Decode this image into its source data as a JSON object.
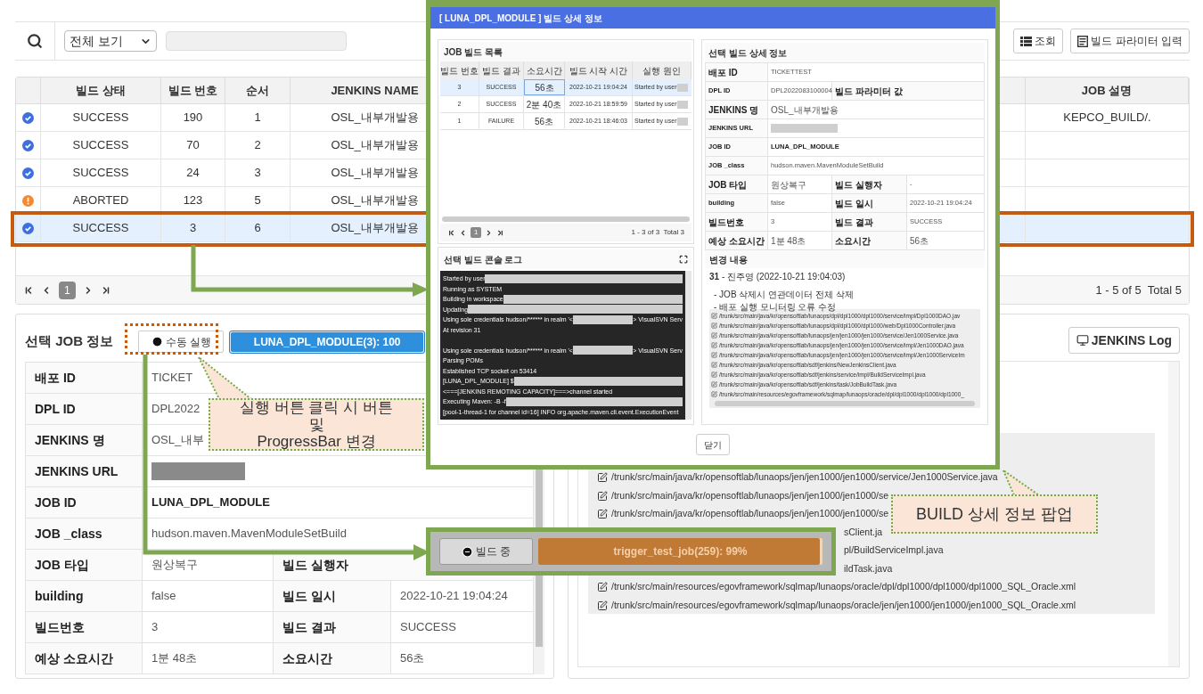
{
  "toolbar": {
    "filter": "전체 보기",
    "buttons": [
      {
        "kind": "list",
        "label": "조회"
      },
      {
        "kind": "form",
        "label": "빌드 파라미터 입력"
      }
    ]
  },
  "build_table": {
    "columns": [
      "빌드 상태",
      "빌드 번호",
      "순서",
      "JENKINS NAME",
      "JOB 설명"
    ],
    "rows": [
      {
        "kind": "success",
        "status": "SUCCESS",
        "number": "190",
        "order": "1",
        "jenkins": "OSL_내부개발용",
        "description": "KEPCO_BUILD/.",
        "selected": false
      },
      {
        "kind": "success",
        "status": "SUCCESS",
        "number": "70",
        "order": "2",
        "jenkins": "OSL_내부개발용",
        "selected": false
      },
      {
        "kind": "success",
        "status": "SUCCESS",
        "number": "24",
        "order": "3",
        "jenkins": "OSL_내부개발용",
        "selected": false
      },
      {
        "kind": "aborted",
        "status": "ABORTED",
        "number": "123",
        "order": "5",
        "jenkins": "OSL_내부개발용",
        "selected": false
      },
      {
        "kind": "success",
        "status": "SUCCESS",
        "number": "3",
        "order": "6",
        "jenkins": "OSL_내부개발용",
        "selected": true
      }
    ],
    "pagination": {
      "page": "1",
      "summary": "1 - 5 of 5  Total 5"
    }
  },
  "job_info": {
    "title": "선택 JOB 정보",
    "run_button": "수동 실행",
    "progress": {
      "label": "LUNA_DPL_MODULE(3): 100",
      "level": 1
    },
    "rows": [
      [
        {
          "kind": "label",
          "text": "배포 ID"
        },
        {
          "kind": "value",
          "text": "TICKET"
        }
      ],
      [
        {
          "kind": "label",
          "text": "DPL ID"
        },
        {
          "kind": "value",
          "text": "DPL2022"
        }
      ],
      [
        {
          "kind": "label",
          "text": "JENKINS 명"
        },
        {
          "kind": "value",
          "text": "OSL_내부"
        }
      ],
      [
        {
          "kind": "label",
          "text": "JENKINS URL"
        },
        {
          "kind": "redacted"
        }
      ],
      [
        {
          "kind": "label",
          "text": "JOB ID"
        },
        {
          "kind": "strong",
          "text": "LUNA_DPL_MODULE"
        }
      ],
      [
        {
          "kind": "label",
          "text": "JOB _class"
        },
        {
          "kind": "value",
          "text": "hudson.maven.MavenModuleSetBuild"
        }
      ],
      [
        {
          "kind": "label",
          "text": "JOB 타입"
        },
        {
          "kind": "value",
          "text": "원상복구"
        },
        {
          "kind": "label",
          "text": "빌드 실행자"
        }
      ],
      [
        {
          "kind": "label",
          "text": "building"
        },
        {
          "kind": "value",
          "text": "false"
        },
        {
          "kind": "label",
          "text": "빌드 일시"
        },
        {
          "kind": "value",
          "text": "2022-10-21 19:04:24"
        }
      ],
      [
        {
          "kind": "label",
          "text": "빌드번호"
        },
        {
          "kind": "value",
          "text": "3"
        },
        {
          "kind": "label",
          "text": "빌드 결과"
        },
        {
          "kind": "value",
          "text": "SUCCESS"
        }
      ],
      [
        {
          "kind": "label",
          "text": "예상 소요시간"
        },
        {
          "kind": "value",
          "text": "1분 48초"
        },
        {
          "kind": "label",
          "text": "소요시간"
        },
        {
          "kind": "value",
          "text": "56초"
        }
      ]
    ]
  },
  "jenkins_log": {
    "button": "JENKINS Log",
    "files": [
      {
        "kind": "full",
        "text": "/trunk/src/main/java/kr/opensoftlab/lunaops/jen/jen1000/jen1000/service/Jen1000Service.java"
      },
      {
        "kind": "full",
        "text": "/trunk/src/main/java/kr/opensoftlab/lunaops/jen/jen1000/jen1000/se"
      },
      {
        "kind": "full",
        "text": "/trunk/src/main/java/kr/opensoftlab/lunaops/jen/jen1000/jen1000/se"
      },
      {
        "kind": "tail",
        "text": "sClient.ja"
      },
      {
        "kind": "tail",
        "text": "pl/BuildServiceImpl.java"
      },
      {
        "kind": "tail",
        "text": "ildTask.java"
      },
      {
        "kind": "full",
        "text": "/trunk/src/main/resources/egovframework/sqlmap/lunaops/oracle/dpl/dpl1000/dpl1000/dpl1000_SQL_Oracle.xml"
      },
      {
        "kind": "full",
        "text": "/trunk/src/main/resources/egovframework/sqlmap/lunaops/oracle/jen/jen1000/jen1000/jen1000_SQL_Oracle.xml"
      }
    ]
  },
  "popup": {
    "title": "[ LUNA_DPL_MODULE ] 빌드 상세 정보",
    "builds": {
      "title": "JOB 빌드 목록",
      "columns": [
        "빌드 번호",
        "빌드 결과",
        "소요시간",
        "빌드 시작 시간",
        "실행 원인"
      ],
      "rows": [
        {
          "number": "3",
          "result": "SUCCESS",
          "duration": "56초",
          "started": "2022-10-21 19:04:24",
          "cause": "Started by user",
          "selected": true
        },
        {
          "number": "2",
          "result": "SUCCESS",
          "duration": "2분 40초",
          "started": "2022-10-21 18:59:59",
          "cause": "Started by user",
          "selected": false
        },
        {
          "number": "1",
          "result": "FAILURE",
          "duration": "56초",
          "started": "2022-10-21 18:46:03",
          "cause": "Started by user",
          "selected": false
        }
      ],
      "pagination": {
        "page": "1",
        "summary": "1 - 3 of 3  Total 3"
      }
    },
    "console": {
      "title": "선택 빌드 콘솔 로그",
      "lines": [
        {
          "kind": "text",
          "parts": [
            {
              "kind": "text",
              "text": "Started by user"
            },
            {
              "kind": "redacted"
            }
          ]
        },
        {
          "kind": "text",
          "parts": [
            {
              "kind": "text",
              "text": "Running as SYSTEM"
            }
          ]
        },
        {
          "kind": "text",
          "parts": [
            {
              "kind": "text",
              "text": "Building in workspace"
            },
            {
              "kind": "redacted"
            }
          ]
        },
        {
          "kind": "text",
          "parts": [
            {
              "kind": "text",
              "text": "Updating"
            },
            {
              "kind": "redacted"
            }
          ]
        },
        {
          "kind": "text",
          "parts": [
            {
              "kind": "text",
              "text": "Using sole credentials hudson/****** in realm '<"
            },
            {
              "kind": "redacted"
            },
            {
              "kind": "text",
              "text": "> VisualSVN Serv"
            }
          ]
        },
        {
          "kind": "text",
          "parts": [
            {
              "kind": "text",
              "text": "At revision 31"
            }
          ]
        },
        {
          "kind": "blank"
        },
        {
          "kind": "text",
          "parts": [
            {
              "kind": "text",
              "text": "Using sole credentials hudson/****** in realm '<"
            },
            {
              "kind": "redacted"
            },
            {
              "kind": "text",
              "text": "> VisualSVN Serv"
            }
          ]
        },
        {
          "kind": "text",
          "parts": [
            {
              "kind": "text",
              "text": "Parsing POMs"
            }
          ]
        },
        {
          "kind": "text",
          "parts": [
            {
              "kind": "text",
              "text": "Established TCP socket on 53414"
            }
          ]
        },
        {
          "kind": "text",
          "parts": [
            {
              "kind": "text",
              "text": "[LUNA_DPL_MODULE] $"
            },
            {
              "kind": "redacted"
            }
          ]
        },
        {
          "kind": "text",
          "parts": [
            {
              "kind": "text",
              "text": "<===[JENKINS REMOTING CAPACITY]===>channel started"
            }
          ]
        },
        {
          "kind": "text",
          "parts": [
            {
              "kind": "text",
              "text": "Executing Maven:  -B -f"
            },
            {
              "kind": "redacted"
            }
          ]
        },
        {
          "kind": "text",
          "parts": [
            {
              "kind": "text",
              "text": "[pool-1-thread-1 for channel id=16] INFO org.apache.maven.cli.event.ExecutionEvent"
            }
          ]
        }
      ]
    },
    "detail": {
      "title": "선택 빌드 상세 정보",
      "rows": [
        [
          {
            "kind": "label",
            "text": "배포 ID"
          },
          {
            "kind": "value",
            "text": "TICKETTEST"
          }
        ],
        [
          {
            "kind": "label",
            "text": "DPL ID"
          },
          {
            "kind": "value",
            "text": "DPL2022083100004"
          },
          {
            "kind": "label",
            "text": "빌드 파라미터 값"
          }
        ],
        [
          {
            "kind": "label",
            "text": "JENKINS 명"
          },
          {
            "kind": "value",
            "text": "OSL_내부개발용"
          }
        ],
        [
          {
            "kind": "label",
            "text": "JENKINS URL"
          },
          {
            "kind": "redacted"
          }
        ],
        [
          {
            "kind": "label",
            "text": "JOB ID"
          },
          {
            "kind": "strong",
            "text": "LUNA_DPL_MODULE"
          }
        ],
        [
          {
            "kind": "label",
            "text": "JOB _class"
          },
          {
            "kind": "value",
            "text": "hudson.maven.MavenModuleSetBuild"
          }
        ],
        [
          {
            "kind": "label",
            "text": "JOB 타입"
          },
          {
            "kind": "value",
            "text": "원상복구"
          },
          {
            "kind": "label",
            "text": "빌드 실행자"
          },
          {
            "kind": "value",
            "text": "-"
          }
        ],
        [
          {
            "kind": "label",
            "text": "building"
          },
          {
            "kind": "value",
            "text": "false"
          },
          {
            "kind": "label",
            "text": "빌드 일시"
          },
          {
            "kind": "value",
            "text": "2022-10-21 19:04:24"
          }
        ],
        [
          {
            "kind": "label",
            "text": "빌드번호"
          },
          {
            "kind": "value",
            "text": "3"
          },
          {
            "kind": "label",
            "text": "빌드 결과"
          },
          {
            "kind": "value",
            "text": "SUCCESS"
          }
        ],
        [
          {
            "kind": "label",
            "text": "예상 소요시간"
          },
          {
            "kind": "value",
            "text": "1분 48초"
          },
          {
            "kind": "label",
            "text": "소요시간"
          },
          {
            "kind": "value",
            "text": "56초"
          }
        ]
      ],
      "changes_title": "변경 내용",
      "changes": {
        "header": "**31** - 진주영 (2022-10-21 19:04:03)",
        "notes": [
          "- JOB 삭제시 연관데이터 전체 삭제",
          "- 배포 실행 모니터링 오류 수정"
        ],
        "files": [
          "/trunk/src/main/java/kr/opensoftlab/lunaops/dpl/dpl1000/dpl1000/service/impl/Dpl1000DAO.jav",
          "/trunk/src/main/java/kr/opensoftlab/lunaops/dpl/dpl1000/dpl1000/web/Dpl1000Controller.java",
          "/trunk/src/main/java/kr/opensoftlab/lunaops/jen/jen1000/jen1000/service/Jen1000Service.java",
          "/trunk/src/main/java/kr/opensoftlab/lunaops/jen/jen1000/jen1000/service/impl/Jen1000DAO.java",
          "/trunk/src/main/java/kr/opensoftlab/lunaops/jen/jen1000/jen1000/service/impl/Jen1000ServiceIm",
          "/trunk/src/main/java/kr/opensoftlab/sdf/jenkins/NewJenkinsClient.java",
          "/trunk/src/main/java/kr/opensoftlab/sdf/jenkins/service/impl/BuildServiceImpl.java",
          "/trunk/src/main/java/kr/opensoftlab/sdf/jenkins/task/JobBuildTask.java",
          "/trunk/src/main/resources/egovframework/sqlmap/lunaops/oracle/dpl/dpl1000/dpl1000/dpl1000_"
        ]
      }
    },
    "close_button": "닫기"
  },
  "building_state": {
    "button": "빌드 중",
    "progress": {
      "label": "trigger_test_job(259): 99%",
      "level": 0.99
    }
  },
  "callouts": [
    {
      "kind": "run",
      "text": "실행 버튼 클릭 시 버튼\n및\nProgressBar 변경"
    },
    {
      "kind": "popup",
      "text": "BUILD 상세 정보 팝업"
    }
  ]
}
